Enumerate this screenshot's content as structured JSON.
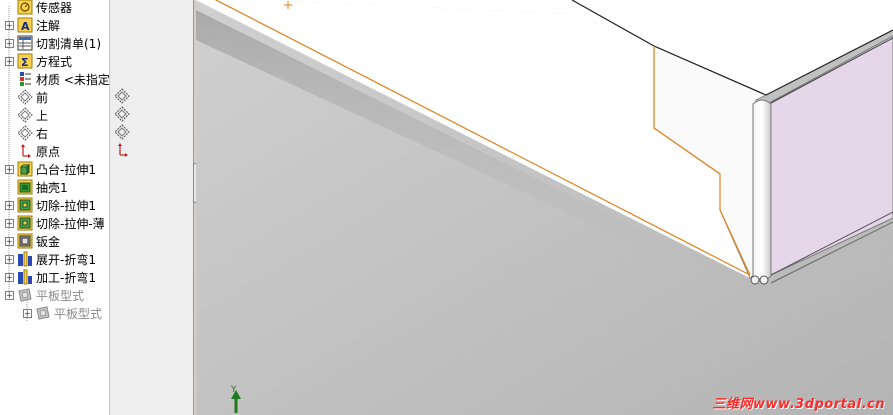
{
  "feature_tree": {
    "items": [
      {
        "label": "传感器",
        "expandable": false,
        "icon": "sensor-icon"
      },
      {
        "label": "注解",
        "expandable": true,
        "icon": "annotation-icon"
      },
      {
        "label": "切割清单(1)",
        "expandable": true,
        "icon": "cut-list-icon"
      },
      {
        "label": "方程式",
        "expandable": true,
        "icon": "equation-icon"
      },
      {
        "label": "材质 <未指定",
        "expandable": false,
        "icon": "material-icon"
      },
      {
        "label": "前",
        "expandable": false,
        "icon": "plane-icon"
      },
      {
        "label": "上",
        "expandable": false,
        "icon": "plane-icon"
      },
      {
        "label": "右",
        "expandable": false,
        "icon": "plane-icon"
      },
      {
        "label": "原点",
        "expandable": false,
        "icon": "origin-icon"
      },
      {
        "label": "凸台-拉伸1",
        "expandable": true,
        "icon": "boss-extrude-icon"
      },
      {
        "label": "抽壳1",
        "expandable": false,
        "icon": "shell-icon"
      },
      {
        "label": "切除-拉伸1",
        "expandable": true,
        "icon": "cut-extrude-icon"
      },
      {
        "label": "切除-拉伸-薄",
        "expandable": true,
        "icon": "cut-extrude-icon"
      },
      {
        "label": "钣金",
        "expandable": true,
        "icon": "sheet-metal-icon"
      },
      {
        "label": "展开-折弯1",
        "expandable": true,
        "icon": "unfold-icon"
      },
      {
        "label": "加工-折弯1",
        "expandable": true,
        "icon": "process-bends-icon"
      },
      {
        "label": "平板型式",
        "expandable": true,
        "icon": "flat-pattern-icon"
      },
      {
        "label": "平板型式",
        "expandable": true,
        "icon": "flat-pattern-icon"
      }
    ]
  },
  "viewport": {
    "axis_label": "Y",
    "watermark": "三维网www.3dportal.cn"
  },
  "colors": {
    "viewport_bg": "#c4c4c4",
    "selection_edge": "#e0801a",
    "part_face": "#ffffff",
    "side_face": "#e6d6ea"
  }
}
